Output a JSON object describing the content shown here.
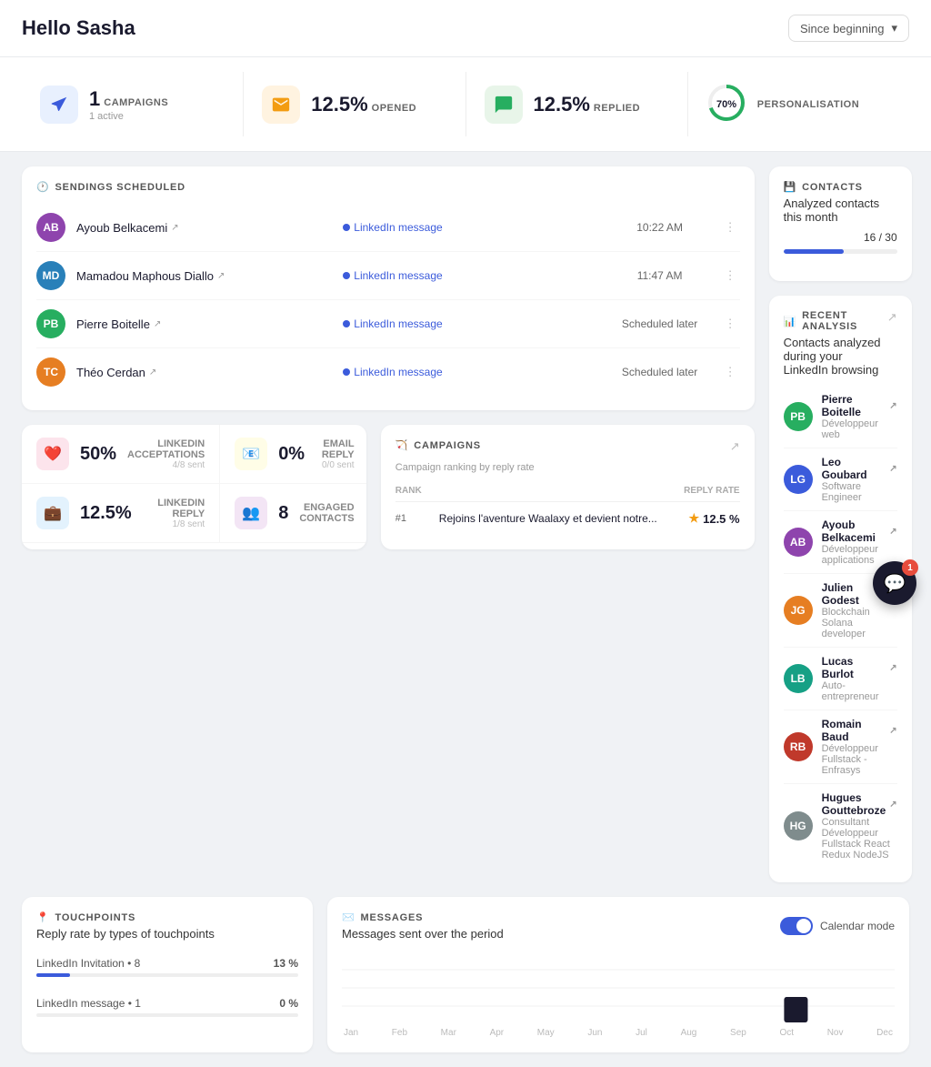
{
  "header": {
    "greeting": "Hello Sasha",
    "period_label": "Since beginning",
    "period_arrow": "▾"
  },
  "stats": [
    {
      "id": "campaigns",
      "icon": "🏹",
      "icon_class": "blue",
      "value": "1",
      "label": "CAMPAIGNS",
      "sub": "1 active"
    },
    {
      "id": "opened",
      "icon": "✉️",
      "icon_class": "orange",
      "value": "12.5%",
      "label": "OPENED",
      "sub": ""
    },
    {
      "id": "replied",
      "icon": "💬",
      "icon_class": "green",
      "value": "12.5%",
      "label": "REPLIED",
      "sub": ""
    },
    {
      "id": "personalisation",
      "icon": "circle",
      "icon_class": "circle",
      "value": "70%",
      "label": "PERSONALISATION",
      "sub": ""
    }
  ],
  "sendings": {
    "title": "SENDINGS SCHEDULED",
    "rows": [
      {
        "name": "Ayoub Belkacemi",
        "channel": "LinkedIn message",
        "time": "10:22 AM",
        "avatar_color": "#8e44ad"
      },
      {
        "name": "Mamadou Maphous Diallo",
        "channel": "LinkedIn message",
        "time": "11:47 AM",
        "avatar_color": "#2980b9"
      },
      {
        "name": "Pierre Boitelle",
        "channel": "LinkedIn message",
        "time": "Scheduled later",
        "avatar_color": "#27ae60"
      },
      {
        "name": "Théo Cerdan",
        "channel": "LinkedIn message",
        "time": "Scheduled later",
        "avatar_color": "#e67e22"
      }
    ]
  },
  "metrics": [
    {
      "id": "linkedin-accept",
      "icon": "❤️",
      "icon_class": "pink",
      "value": "50%",
      "label": "LINKEDIN ACCEPTATIONS",
      "sub": "4/8 sent"
    },
    {
      "id": "email-reply",
      "icon": "📧",
      "icon_class": "yellow",
      "value": "0%",
      "label": "EMAIL REPLY",
      "sub": "0/0 sent"
    },
    {
      "id": "linkedin-reply",
      "icon": "💼",
      "icon_class": "blue-light",
      "value": "12.5%",
      "label": "LINKEDIN REPLY",
      "sub": "1/8 sent"
    },
    {
      "id": "engaged",
      "icon": "👥",
      "icon_class": "purple",
      "value": "8",
      "label": "ENGAGED CONTACTS",
      "sub": ""
    }
  ],
  "campaigns_section": {
    "title": "CAMPAIGNS",
    "subtitle": "Campaign ranking by reply rate",
    "col_rank": "RANK",
    "col_rate": "REPLY RATE",
    "rows": [
      {
        "rank": "#1",
        "name": "Rejoins l'aventure Waalaxy et devient notre...",
        "rate": "12.5 %",
        "star": true
      }
    ]
  },
  "contacts": {
    "title": "CONTACTS",
    "subtitle": "Analyzed contacts this month",
    "progress_current": 16,
    "progress_max": 30,
    "progress_label": "16 / 30",
    "progress_pct": 53
  },
  "recent_analysis": {
    "title": "RECENT ANALYSIS",
    "subtitle": "Contacts analyzed during your LinkedIn browsing",
    "items": [
      {
        "name": "Pierre Boitelle",
        "role": "Développeur web",
        "avatar_color": "#27ae60"
      },
      {
        "name": "Leo Goubard",
        "role": "Software Engineer",
        "avatar_color": "#3b5bdb"
      },
      {
        "name": "Ayoub Belkacemi",
        "role": "Développeur applications",
        "avatar_color": "#8e44ad"
      },
      {
        "name": "Julien Godest",
        "role": "Blockchain Solana developer",
        "avatar_color": "#e67e22"
      },
      {
        "name": "Lucas Burlot",
        "role": "Auto-entrepreneur",
        "avatar_color": "#16a085"
      },
      {
        "name": "Romain Baud",
        "role": "Développeur Fullstack - Enfrasys",
        "avatar_color": "#c0392b"
      },
      {
        "name": "Hugues Gouttebroze",
        "role": "Consultant Développeur Fullstack React Redux NodeJS",
        "avatar_color": "#7f8c8d"
      }
    ]
  },
  "touchpoints": {
    "title": "TOUCHPOINTS",
    "subtitle": "Reply rate by types of touchpoints",
    "items": [
      {
        "name": "LinkedIn Invitation",
        "count": 8,
        "pct": "13 %",
        "fill": 13
      },
      {
        "name": "LinkedIn message",
        "count": 1,
        "pct": "0 %",
        "fill": 0
      }
    ]
  },
  "messages": {
    "title": "MESSAGES",
    "subtitle": "Messages sent over the period",
    "calendar_label": "Calendar mode",
    "months": [
      "Jan",
      "Feb",
      "Mar",
      "Apr",
      "May",
      "Jun",
      "Jul",
      "Aug",
      "Sep",
      "Oct",
      "Nov",
      "Dec"
    ],
    "chart_data": [
      0,
      0,
      0,
      0,
      0,
      0,
      0,
      0,
      0,
      5,
      0,
      0
    ]
  },
  "chat": {
    "badge": "1"
  }
}
